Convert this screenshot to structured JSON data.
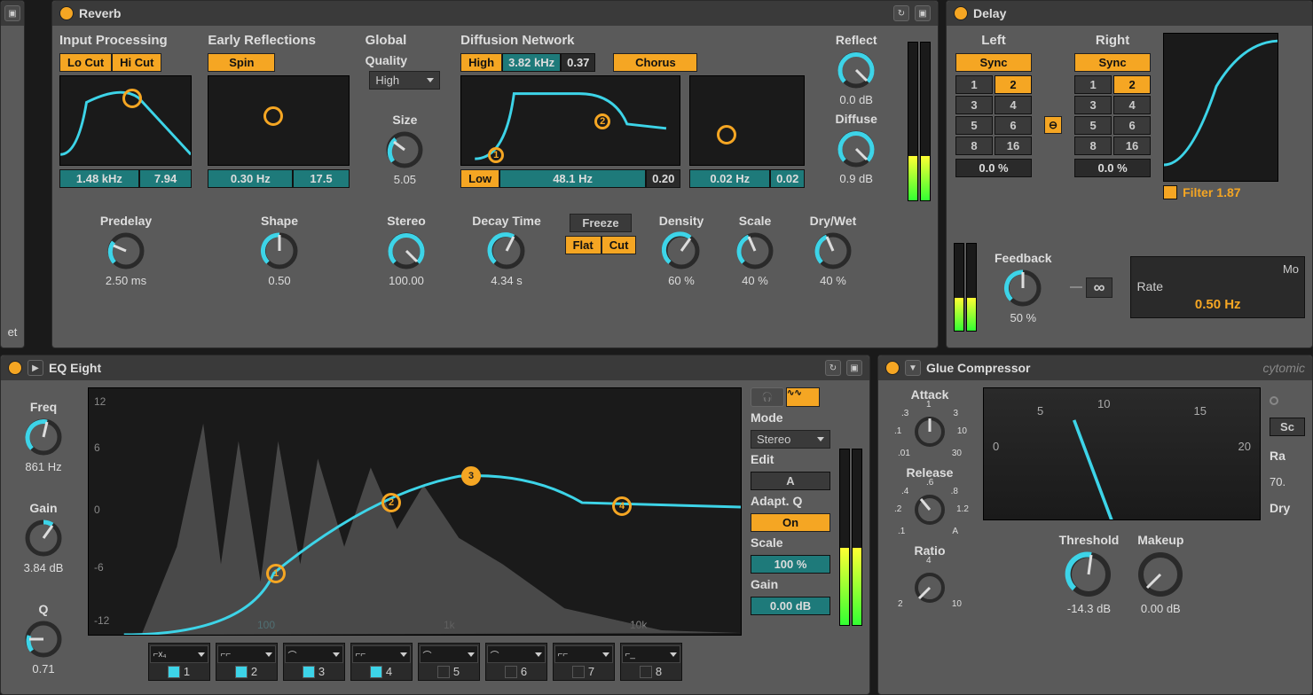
{
  "reverb": {
    "title": "Reverb",
    "input_processing": {
      "label": "Input Processing",
      "lo_cut": "Lo Cut",
      "hi_cut": "Hi Cut",
      "freq": "1.48 kHz",
      "q": "7.94"
    },
    "early_reflections": {
      "label": "Early Reflections",
      "spin": "Spin",
      "freq": "0.30 Hz",
      "amount": "17.5"
    },
    "global": {
      "label": "Global",
      "quality_label": "Quality",
      "quality": "High",
      "size_label": "Size",
      "size": "5.05"
    },
    "diffusion": {
      "label": "Diffusion Network",
      "high": "High",
      "high_freq": "3.82 kHz",
      "high_q": "0.37",
      "chorus": "Chorus",
      "low": "Low",
      "low_freq": "48.1 Hz",
      "low_q": "0.20",
      "ch_freq": "0.02 Hz",
      "ch_amt": "0.02"
    },
    "reflect": {
      "label": "Reflect",
      "value": "0.0 dB"
    },
    "diffuse": {
      "label": "Diffuse",
      "value": "0.9 dB"
    },
    "predelay": {
      "label": "Predelay",
      "value": "2.50 ms"
    },
    "shape": {
      "label": "Shape",
      "value": "0.50"
    },
    "stereo": {
      "label": "Stereo",
      "value": "100.00"
    },
    "decay": {
      "label": "Decay Time",
      "value": "4.34 s"
    },
    "freeze": {
      "label": "Freeze",
      "flat": "Flat",
      "cut": "Cut"
    },
    "density": {
      "label": "Density",
      "value": "60 %"
    },
    "scale": {
      "label": "Scale",
      "value": "40 %"
    },
    "drywet": {
      "label": "Dry/Wet",
      "value": "40 %"
    }
  },
  "delay": {
    "title": "Delay",
    "left": {
      "label": "Left",
      "sync": "Sync",
      "offset": "0.0 %"
    },
    "right": {
      "label": "Right",
      "sync": "Sync",
      "offset": "0.0 %"
    },
    "nums": [
      "1",
      "2",
      "3",
      "4",
      "5",
      "6",
      "8",
      "16"
    ],
    "link_icon": "link-icon",
    "feedback": {
      "label": "Feedback",
      "value": "50 %"
    },
    "infinity": "∞",
    "filter": {
      "label": "Filter",
      "value": "1.87"
    },
    "mode_label": "Mo",
    "rate": {
      "label": "Rate",
      "value": "0.50 Hz"
    }
  },
  "eq": {
    "title": "EQ Eight",
    "freq": {
      "label": "Freq",
      "value": "861 Hz"
    },
    "gain": {
      "label": "Gain",
      "value": "3.84 dB"
    },
    "q": {
      "label": "Q",
      "value": "0.71"
    },
    "axis": {
      "m12": "-12",
      "m6": "-6",
      "zero": "0",
      "p6": "6",
      "p12": "12",
      "hz100": "100",
      "hz1k": "1k",
      "hz10k": "10k"
    },
    "bands": [
      "1",
      "2",
      "3",
      "4",
      "5",
      "6",
      "7",
      "8"
    ],
    "mode_label": "Mode",
    "mode": "Stereo",
    "edit_label": "Edit",
    "edit": "A",
    "adaptq_label": "Adapt. Q",
    "adaptq": "On",
    "scale_label": "Scale",
    "scale": "100 %",
    "out_gain_label": "Gain",
    "out_gain": "0.00 dB"
  },
  "glue": {
    "title": "Glue Compressor",
    "brand": "cytomic",
    "attack": {
      "label": "Attack",
      "ticks": [
        ".01",
        ".1",
        ".3",
        "1",
        "3",
        "10",
        "30"
      ]
    },
    "release": {
      "label": "Release",
      "ticks": [
        ".1",
        ".2",
        ".4",
        ".6",
        ".8",
        "1.2",
        "A"
      ]
    },
    "ratio": {
      "label": "Ratio",
      "ticks": [
        "2",
        "4",
        "10"
      ]
    },
    "meter": {
      "ticks": [
        "0",
        "5",
        "10",
        "15",
        "20"
      ]
    },
    "threshold": {
      "label": "Threshold",
      "value": "-14.3 dB"
    },
    "makeup": {
      "label": "Makeup",
      "value": "0.00 dB"
    },
    "range_label": "Ra",
    "range_val": "70.",
    "sc_label": "Sc",
    "dry_label": "Dry"
  },
  "extra": {
    "et": "et"
  }
}
